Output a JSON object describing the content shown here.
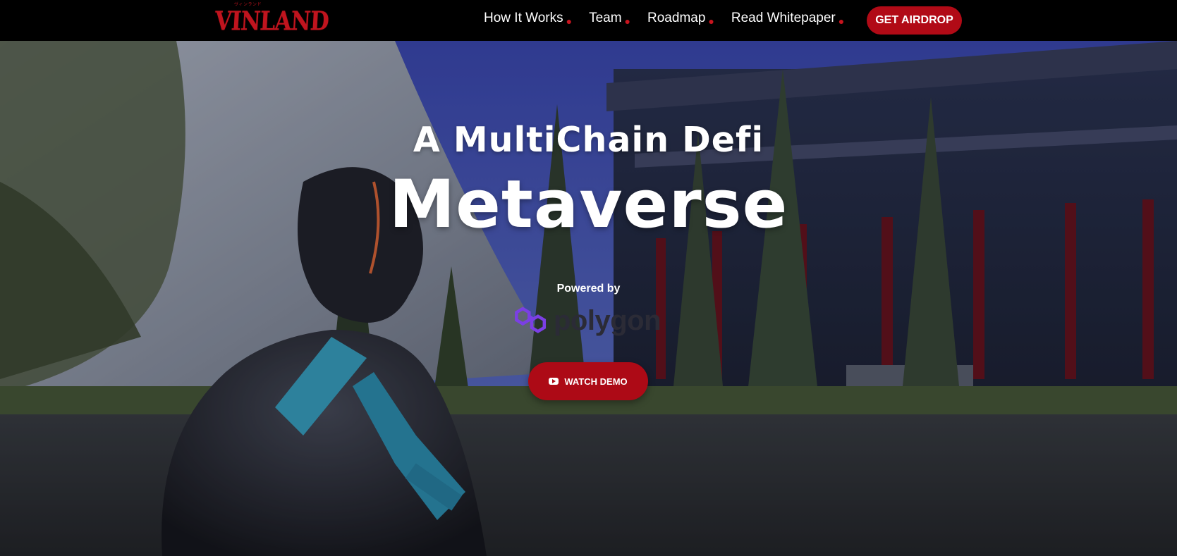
{
  "nav": {
    "logo": {
      "text": "VINLAND",
      "subtext": "ヴィンランド"
    },
    "links": [
      {
        "label": "How It Works"
      },
      {
        "label": "Team"
      },
      {
        "label": "Roadmap"
      },
      {
        "label": "Read Whitepaper"
      }
    ],
    "cta_label": "GET AIRDROP"
  },
  "hero": {
    "subtitle": "A MultiChain Defi",
    "title": "Metaverse",
    "powered_by": "Powered by",
    "partner": "polygon",
    "demo_label": "WATCH DEMO"
  },
  "colors": {
    "accent": "#b10a16",
    "nav_background": "#000000",
    "sky": "#3f4fb5",
    "polygon_purple": "#7b3fe4"
  }
}
